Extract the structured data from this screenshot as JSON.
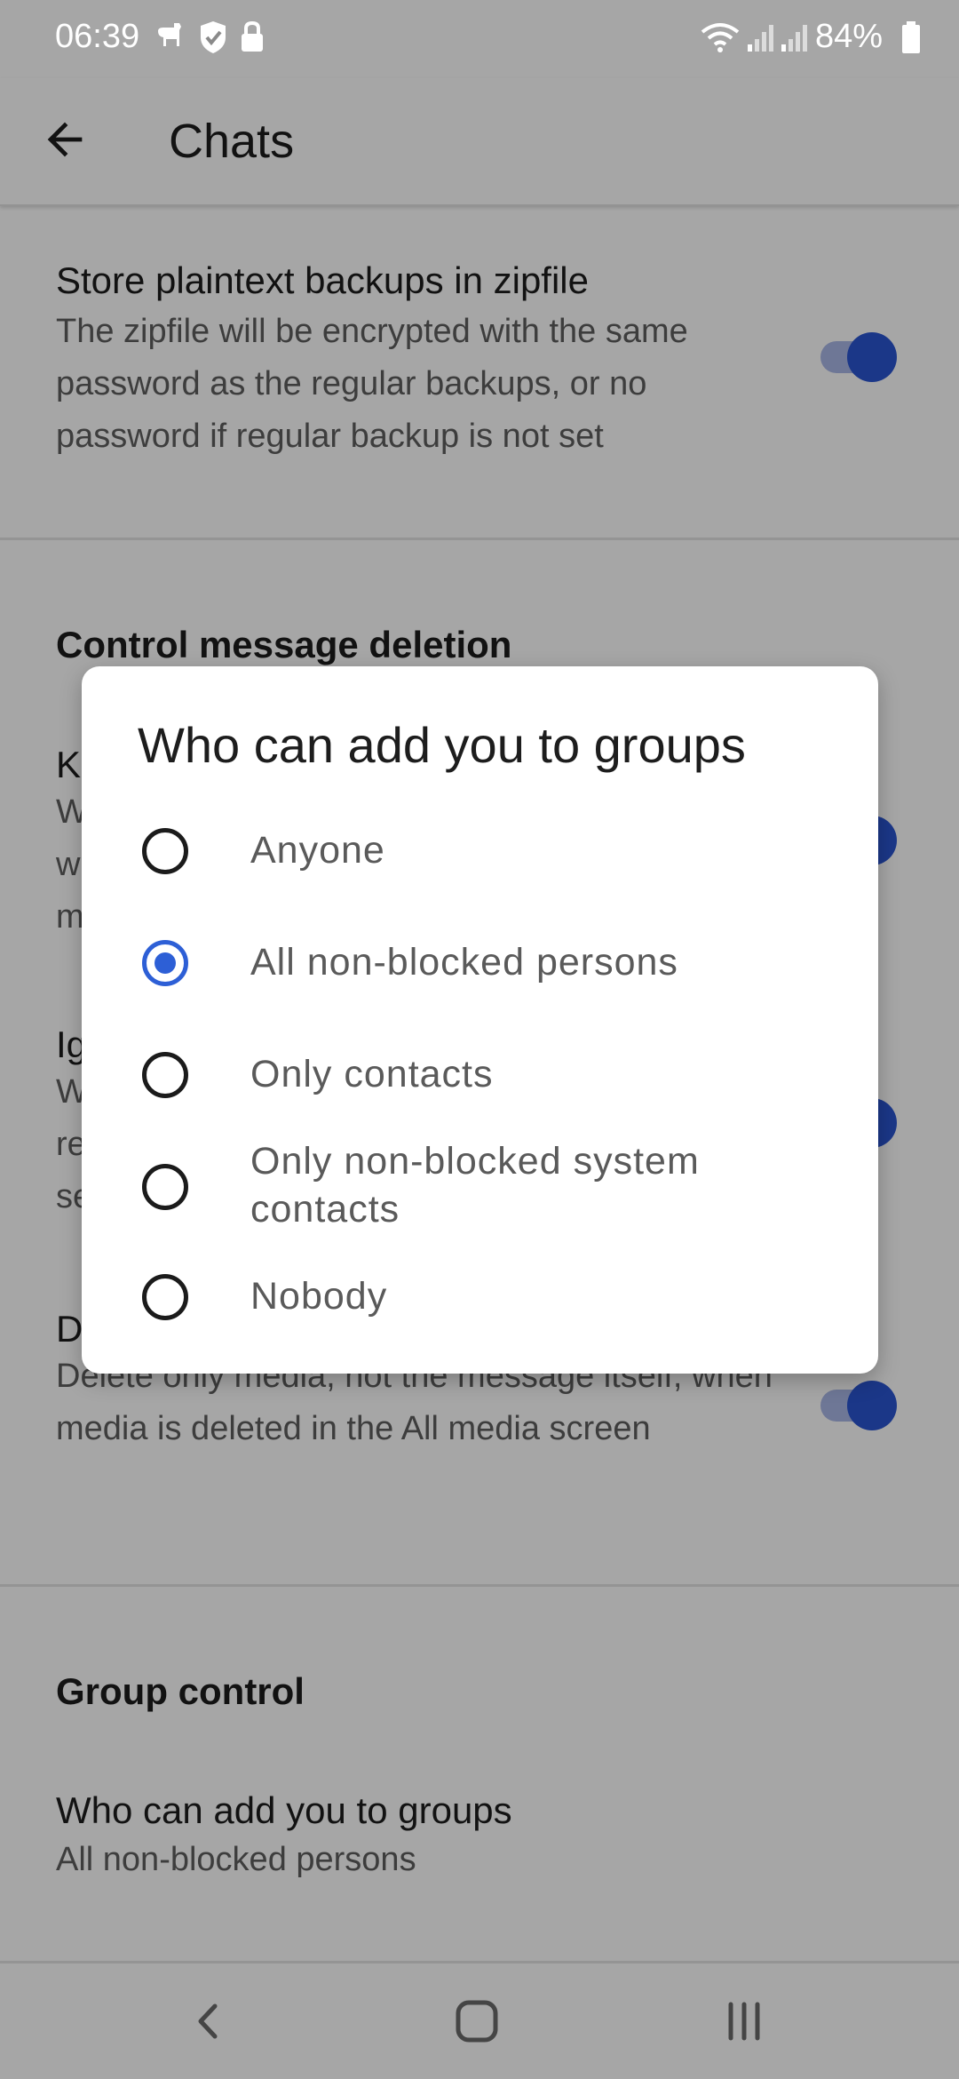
{
  "status_bar": {
    "time": "06:39",
    "battery": "84%"
  },
  "app_bar": {
    "title": "Chats"
  },
  "settings": {
    "zip_backup": {
      "title": "Store plaintext backups in zipfile",
      "summary": "The zipfile will be encrypted with the same password as the regular backups, or no password if regular backup is not set",
      "enabled": true
    },
    "section_deletion": "Control message deletion",
    "keep_item": {
      "title_visible": "K",
      "summary_visible": [
        "W",
        "w",
        "m"
      ],
      "enabled": true
    },
    "ignore_item": {
      "title_visible": "Ig",
      "summary_visible": [
        "W",
        "re",
        "se"
      ],
      "enabled": true
    },
    "delete_media_item": {
      "title_visible": "D",
      "summary": "Delete only media, not the message itself, when media is deleted in the All media screen",
      "enabled": true
    },
    "section_group": "Group control",
    "group_add": {
      "title": "Who can add you to groups",
      "summary": "All non-blocked persons"
    }
  },
  "dialog": {
    "title": "Who can add you to groups",
    "options": [
      {
        "label": "Anyone",
        "checked": false
      },
      {
        "label": "All non-blocked persons",
        "checked": true
      },
      {
        "label": "Only contacts",
        "checked": false
      },
      {
        "label": "Only non-blocked system contacts",
        "checked": false
      },
      {
        "label": "Nobody",
        "checked": false
      }
    ]
  },
  "colors": {
    "accent": "#2d5fd6",
    "switch_thumb": "#2a55d2"
  },
  "icons": {
    "back": "arrow-left-icon",
    "nav_back": "chevron-left-icon",
    "nav_home": "home-square-icon",
    "nav_recents": "recents-icon"
  }
}
